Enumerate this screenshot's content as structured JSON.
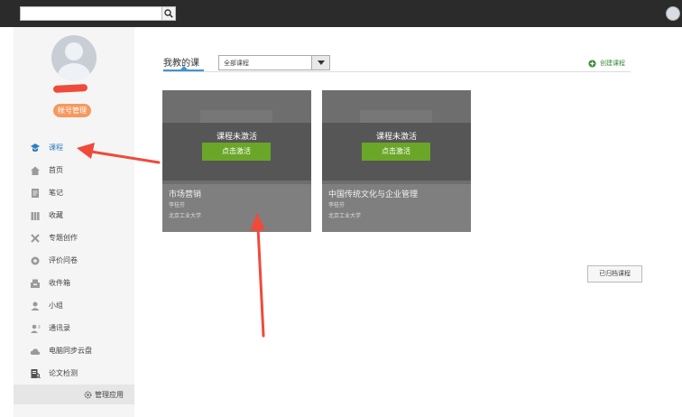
{
  "search": {
    "placeholder": "",
    "value": ""
  },
  "sidebar": {
    "account_button": "帐号管理",
    "items": [
      {
        "label": "课程",
        "icon": "course-icon",
        "active": true
      },
      {
        "label": "首页",
        "icon": "home-icon",
        "active": false
      },
      {
        "label": "笔记",
        "icon": "notes-icon",
        "active": false
      },
      {
        "label": "收藏",
        "icon": "favorites-icon",
        "active": false
      },
      {
        "label": "专题创作",
        "icon": "topic-create-icon",
        "active": false
      },
      {
        "label": "评价问卷",
        "icon": "survey-icon",
        "active": false
      },
      {
        "label": "收件箱",
        "icon": "inbox-icon",
        "active": false
      },
      {
        "label": "小组",
        "icon": "group-icon",
        "active": false
      },
      {
        "label": "通讯录",
        "icon": "contacts-icon",
        "active": false
      },
      {
        "label": "电脑同步云盘",
        "icon": "cloud-sync-icon",
        "active": false
      },
      {
        "label": "论文检测",
        "icon": "paper-check-icon",
        "active": false
      }
    ],
    "manage_apps": "管理应用"
  },
  "main": {
    "tab_label": "我教的课",
    "filter": {
      "selected": "全部课程"
    },
    "create_label": "创建课程",
    "courses": [
      {
        "status": "课程未激活",
        "action": "点击激活",
        "title": "市场营销",
        "teacher": "李桂芬",
        "school": "北京工业大学"
      },
      {
        "status": "课程未激活",
        "action": "点击激活",
        "title": "中国传统文化与企业管理",
        "teacher": "李桂芬",
        "school": "北京工业大学"
      }
    ],
    "archived_label": "已归档课程"
  },
  "colors": {
    "topbar": "#2b2b2b",
    "accent": "#3c94d6",
    "activate": "#6aa628",
    "account_button": "#f59a5f",
    "annotation_arrow": "#f04a3a"
  }
}
